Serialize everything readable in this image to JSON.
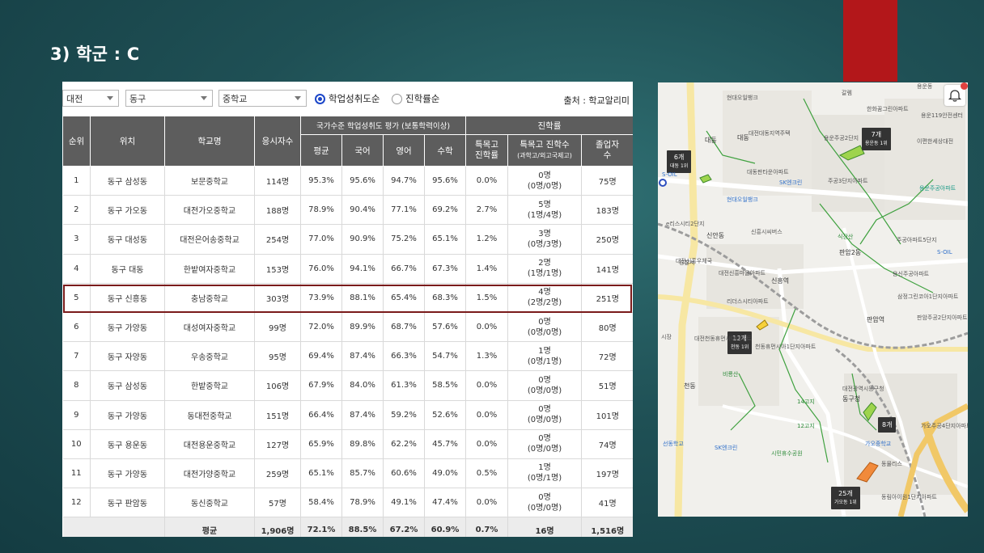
{
  "slide": {
    "title": "3) 학군 : C"
  },
  "filters": {
    "region": "대전",
    "district": "동구",
    "school_level": "중학교",
    "sort_options": [
      {
        "label": "학업성취도순",
        "selected": true
      },
      {
        "label": "진학률순",
        "selected": false
      }
    ],
    "source": "출처 : 학교알리미"
  },
  "table": {
    "headers": {
      "rank": "순위",
      "location": "위치",
      "school": "학교명",
      "examinees": "응시자수",
      "national_group": "국가수준 학업성취도 평가 (보통학력이상)",
      "avg": "평균",
      "korean": "국어",
      "english": "영어",
      "math": "수학",
      "advance_group": "진학률",
      "special_rate_1": "특목고",
      "special_rate_2": "진학률",
      "special_count_1": "특목고 진학수",
      "special_count_2": "(과학고/외고국제고)",
      "grad_1": "졸업자",
      "grad_2": "수"
    },
    "rows": [
      {
        "rank": "1",
        "location": "동구 삼성동",
        "school": "보문중학교",
        "examinees": "114명",
        "avg": "95.3%",
        "korean": "95.6%",
        "english": "94.7%",
        "math": "95.6%",
        "special_rate": "0.0%",
        "special_total": "0명",
        "special_detail": "(0명/0명)",
        "graduates": "75명"
      },
      {
        "rank": "2",
        "location": "동구 가오동",
        "school": "대전가오중학교",
        "examinees": "188명",
        "avg": "78.9%",
        "korean": "90.4%",
        "english": "77.1%",
        "math": "69.2%",
        "special_rate": "2.7%",
        "special_total": "5명",
        "special_detail": "(1명/4명)",
        "graduates": "183명"
      },
      {
        "rank": "3",
        "location": "동구 대성동",
        "school": "대전은어송중학교",
        "examinees": "254명",
        "avg": "77.0%",
        "korean": "90.9%",
        "english": "75.2%",
        "math": "65.1%",
        "special_rate": "1.2%",
        "special_total": "3명",
        "special_detail": "(0명/3명)",
        "graduates": "250명"
      },
      {
        "rank": "4",
        "location": "동구 대동",
        "school": "한밭여자중학교",
        "examinees": "153명",
        "avg": "76.0%",
        "korean": "94.1%",
        "english": "66.7%",
        "math": "67.3%",
        "special_rate": "1.4%",
        "special_total": "2명",
        "special_detail": "(1명/1명)",
        "graduates": "141명"
      },
      {
        "rank": "5",
        "location": "동구 신흥동",
        "school": "충남중학교",
        "examinees": "303명",
        "avg": "73.9%",
        "korean": "88.1%",
        "english": "65.4%",
        "math": "68.3%",
        "special_rate": "1.5%",
        "special_total": "4명",
        "special_detail": "(2명/2명)",
        "graduates": "251명"
      },
      {
        "rank": "6",
        "location": "동구 가양동",
        "school": "대성여자중학교",
        "examinees": "99명",
        "avg": "72.0%",
        "korean": "89.9%",
        "english": "68.7%",
        "math": "57.6%",
        "special_rate": "0.0%",
        "special_total": "0명",
        "special_detail": "(0명/0명)",
        "graduates": "80명"
      },
      {
        "rank": "7",
        "location": "동구 자양동",
        "school": "우송중학교",
        "examinees": "95명",
        "avg": "69.4%",
        "korean": "87.4%",
        "english": "66.3%",
        "math": "54.7%",
        "special_rate": "1.3%",
        "special_total": "1명",
        "special_detail": "(0명/1명)",
        "graduates": "72명"
      },
      {
        "rank": "8",
        "location": "동구 삼성동",
        "school": "한밭중학교",
        "examinees": "106명",
        "avg": "67.9%",
        "korean": "84.0%",
        "english": "61.3%",
        "math": "58.5%",
        "special_rate": "0.0%",
        "special_total": "0명",
        "special_detail": "(0명/0명)",
        "graduates": "51명"
      },
      {
        "rank": "9",
        "location": "동구 가양동",
        "school": "동대전중학교",
        "examinees": "151명",
        "avg": "66.4%",
        "korean": "87.4%",
        "english": "59.2%",
        "math": "52.6%",
        "special_rate": "0.0%",
        "special_total": "0명",
        "special_detail": "(0명/0명)",
        "graduates": "101명"
      },
      {
        "rank": "10",
        "location": "동구 용운동",
        "school": "대전용운중학교",
        "examinees": "127명",
        "avg": "65.9%",
        "korean": "89.8%",
        "english": "62.2%",
        "math": "45.7%",
        "special_rate": "0.0%",
        "special_total": "0명",
        "special_detail": "(0명/0명)",
        "graduates": "74명"
      },
      {
        "rank": "11",
        "location": "동구 가양동",
        "school": "대전가양중학교",
        "examinees": "259명",
        "avg": "65.1%",
        "korean": "85.7%",
        "english": "60.6%",
        "math": "49.0%",
        "special_rate": "0.5%",
        "special_total": "1명",
        "special_detail": "(0명/1명)",
        "graduates": "197명"
      },
      {
        "rank": "12",
        "location": "동구 판암동",
        "school": "동신중학교",
        "examinees": "57명",
        "avg": "58.4%",
        "korean": "78.9%",
        "english": "49.1%",
        "math": "47.4%",
        "special_rate": "0.0%",
        "special_total": "0명",
        "special_detail": "(0명/0명)",
        "graduates": "41명"
      }
    ],
    "average_row": {
      "label": "평균",
      "examinees": "1,906명",
      "avg": "72.1%",
      "korean": "88.5%",
      "english": "67.2%",
      "math": "60.9%",
      "special_rate": "0.7%",
      "special_total": "16명",
      "graduates": "1,516명"
    }
  },
  "map": {
    "badges": [
      {
        "count": "6개",
        "sub": "대동 1위"
      },
      {
        "count": "7개",
        "sub": "용운동 1위"
      },
      {
        "count": "12개",
        "sub": "천동 1위"
      },
      {
        "count": "8개",
        "sub": ""
      },
      {
        "count": "25개",
        "sub": "가오동 1위"
      }
    ],
    "labels": {
      "l1": "용운동",
      "l2": "갈렘",
      "l3": "한화꿈그린아파트",
      "l4": "용운119안전센터",
      "l5": "현대오일뱅크",
      "l6": "대동",
      "l7": "대동",
      "l8": "대전대동지역주택",
      "l9": "용운주공2단지",
      "l10": "이편한세상대전",
      "l11": "대동판타운아파트",
      "l12": "SK엔크린",
      "l13": "주공3단지아파트",
      "l14": "용운주공아파트",
      "l15": "현대오일뱅크",
      "l16": "e리스시티2단지",
      "l17": "신흥시씨버스",
      "l18": "신안동",
      "l19": "식장산",
      "l20": "주공아파트5단지",
      "l21": "S-OIL",
      "l22": "대전신흥우체국",
      "l23": "판암2동",
      "l24": "신흥역",
      "l25": "대전신흥마을아파트",
      "l26": "용신주공아파트",
      "l27": "리더스시티아파트",
      "l28": "판암역",
      "l29": "삼정그린코아1단지아파트",
      "l30": "판암주공2단지아파트",
      "l31": "대전천동휴먼시아아파트",
      "l32": "천동휴먼시아1단지아파트",
      "l33": "비룡산",
      "l34": "동구청",
      "l35": "대전광역시동구청",
      "l36": "14고지",
      "l37": "12고지",
      "l38": "SK엔크린",
      "l39": "시민휴수공원",
      "l40": "가오주공4단지아파트",
      "l41": "가오중학교",
      "l42": "동물리스",
      "l43": "동림아이원1단지아파트",
      "l44": "S-OIL",
      "l45": "시장",
      "l46": "경찰서",
      "l47": "천동",
      "l48": "선동학교"
    }
  }
}
